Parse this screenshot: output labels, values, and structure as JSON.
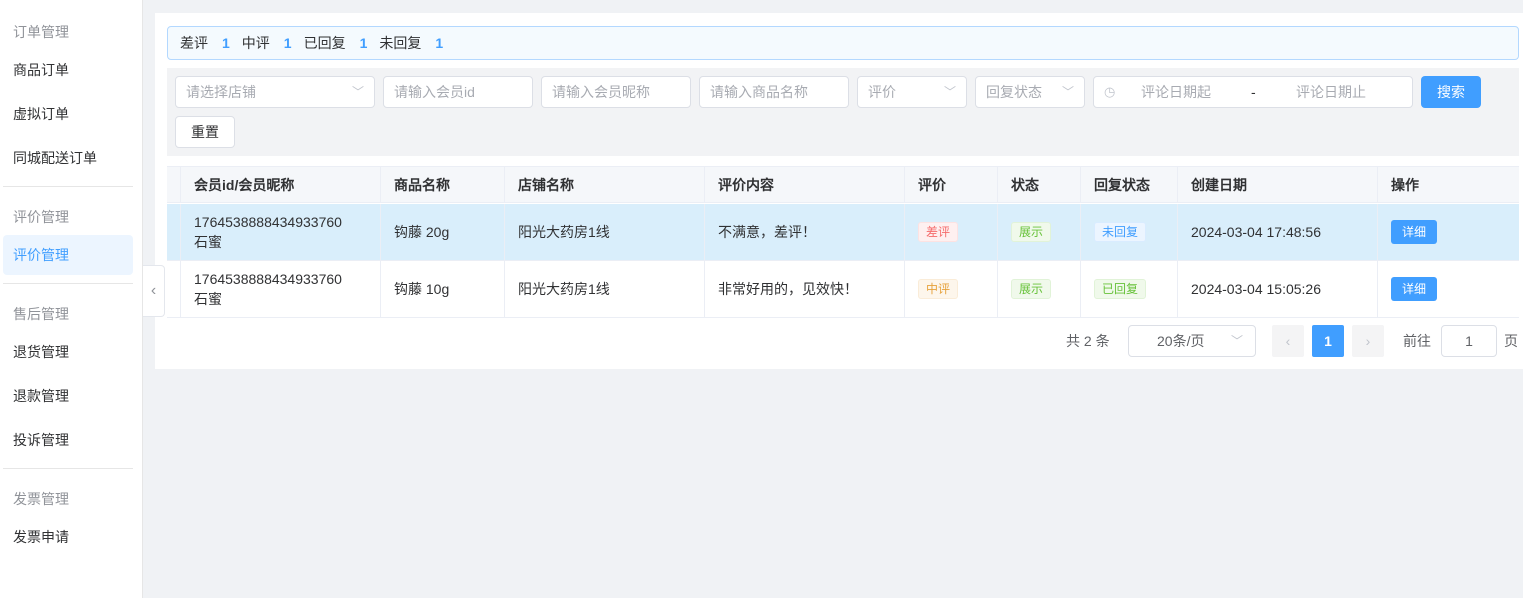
{
  "sidebar": {
    "groups": [
      {
        "title": "订单管理",
        "items": [
          "商品订单",
          "虚拟订单",
          "同城配送订单"
        ]
      },
      {
        "title": "评价管理",
        "items": [
          "评价管理"
        ]
      },
      {
        "title": "售后管理",
        "items": [
          "退货管理",
          "退款管理",
          "投诉管理"
        ]
      },
      {
        "title": "发票管理",
        "items": [
          "发票申请"
        ]
      }
    ],
    "active_item": "评价管理",
    "collapse_icon": "chevron-left-icon"
  },
  "summary": {
    "bad_label": "差评",
    "bad_count": "1",
    "mid_label": "中评",
    "mid_count": "1",
    "replied_label": "已回复",
    "replied_count": "1",
    "unreplied_label": "未回复",
    "unreplied_count": "1"
  },
  "filters": {
    "store_placeholder": "请选择店铺",
    "member_id_placeholder": "请输入会员id",
    "nickname_placeholder": "请输入会员昵称",
    "product_placeholder": "请输入商品名称",
    "rating_placeholder": "评价",
    "reply_status_placeholder": "回复状态",
    "date_start_placeholder": "评论日期起",
    "date_sep": "-",
    "date_end_placeholder": "评论日期止",
    "search_label": "搜索",
    "reset_label": "重置",
    "dropdown_icon": "chevron-down-icon",
    "date_icon": "clock-icon"
  },
  "table": {
    "headers": [
      "会员id/会员昵称",
      "商品名称",
      "店铺名称",
      "评价内容",
      "评价",
      "状态",
      "回复状态",
      "创建日期",
      "操作"
    ],
    "rows": [
      {
        "member_id": "1764538888434933760",
        "nickname": "石蜜",
        "product": "钩藤 20g",
        "store": "阳光大药房1线",
        "content": "不满意，差评！",
        "rating": "差评",
        "status": "展示",
        "reply_status": "未回复",
        "created": "2024-03-04 17:48:56",
        "action": "详细"
      },
      {
        "member_id": "1764538888434933760",
        "nickname": "石蜜",
        "product": "钩藤 10g",
        "store": "阳光大药房1线",
        "content": "非常好用的，见效快！",
        "rating": "中评",
        "status": "展示",
        "reply_status": "已回复",
        "created": "2024-03-04 15:05:26",
        "action": "详细"
      }
    ]
  },
  "pagination": {
    "total": "共 2 条",
    "page_size": "20条/页",
    "current_page": "1",
    "goto_label": "前往",
    "goto_value": "1",
    "page_suffix": "页"
  },
  "colors": {
    "accent": "#409eff",
    "danger": "#f56c6c",
    "warning": "#e6a23c",
    "success": "#67c23a",
    "row_highlight": "#d9eefb"
  }
}
